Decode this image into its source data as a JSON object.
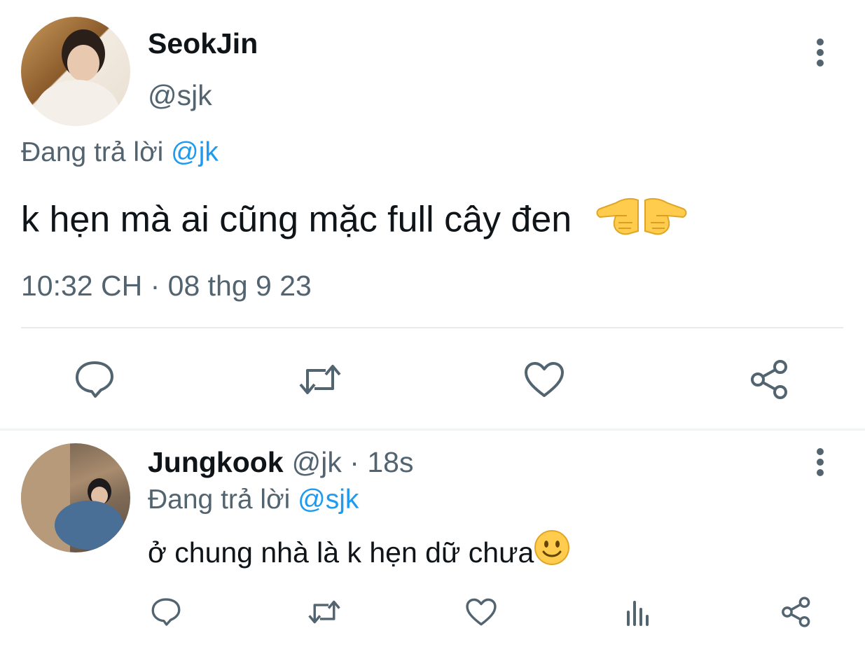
{
  "main_tweet": {
    "author_name": "SeokJin",
    "author_handle": "@sjk",
    "replying_to_label": "Đang trả lời",
    "replying_to_handle": "@jk",
    "text": "k hẹn mà ai cũng mặc full cây đen",
    "emoji": "pointing-hands-emoji",
    "timestamp": "10:32 CH · 08 thg 9 23",
    "actions": [
      "reply-icon",
      "retweet-icon",
      "like-icon",
      "share-icon"
    ]
  },
  "reply_tweet": {
    "author_name": "Jungkook",
    "author_handle": "@jk",
    "separator": "·",
    "time_ago": "18s",
    "replying_to_label": "Đang trả lời",
    "replying_to_handle": "@sjk",
    "text": "ở chung nhà là k hẹn dữ chưa",
    "emoji": "smiling-face-emoji",
    "actions": [
      "reply-icon",
      "retweet-icon",
      "like-icon",
      "views-icon",
      "share-icon"
    ]
  },
  "colors": {
    "text_primary": "#0f1419",
    "text_secondary": "#536471",
    "mention": "#1d9bf0",
    "divider": "#eff3f4"
  }
}
